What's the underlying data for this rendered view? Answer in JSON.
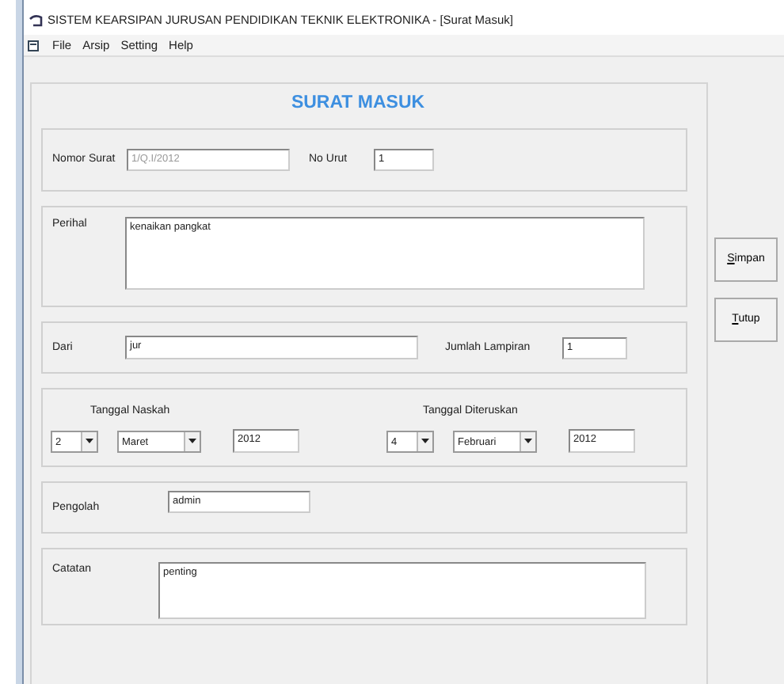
{
  "window": {
    "title": "SISTEM KEARSIPAN JURUSAN PENDIDIKAN TEKNIK ELEKTRONIKA - [Surat Masuk]"
  },
  "menu": [
    "File",
    "Arsip",
    "Setting",
    "Help"
  ],
  "form": {
    "heading": "SURAT MASUK",
    "nomor_surat": {
      "label": "Nomor Surat",
      "value": "1/Q.I/2012",
      "disabled": true
    },
    "no_urut": {
      "label": "No Urut",
      "value": "1"
    },
    "perihal": {
      "label": "Perihal",
      "value": "kenaikan pangkat"
    },
    "dari": {
      "label": "Dari",
      "value": "jur"
    },
    "jumlah_lampiran": {
      "label": "Jumlah Lampiran",
      "value": "1"
    },
    "tanggal_naskah": {
      "label": "Tanggal Naskah",
      "day": "2",
      "month": "Maret",
      "year": "2012"
    },
    "tanggal_diteruskan": {
      "label": "Tanggal Diteruskan",
      "day": "4",
      "month": "Februari",
      "year": "2012"
    },
    "pengolah": {
      "label": "Pengolah",
      "value": "admin"
    },
    "catatan": {
      "label": "Catatan",
      "value": "penting"
    }
  },
  "buttons": [
    "Simpan",
    "Tutup"
  ]
}
